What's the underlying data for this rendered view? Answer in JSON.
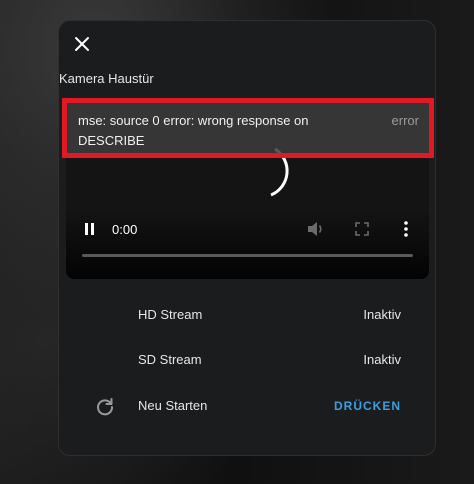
{
  "dialog": {
    "title": "Kamera Haustür",
    "close_icon": "close-icon"
  },
  "player": {
    "error_message": "mse: source 0 error: wrong response on DESCRIBE",
    "error_tag": "error",
    "time": "0:00",
    "controls": [
      "pause-icon",
      "volume-icon",
      "fullscreen-icon",
      "more-vert-icon"
    ],
    "progress": 0
  },
  "entities": [
    {
      "label": "HD Stream",
      "value": "Inaktiv"
    },
    {
      "label": "SD Stream",
      "value": "Inaktiv"
    },
    {
      "label": "Neu Starten",
      "action": "DRÜCKEN",
      "icon": "restart-icon"
    }
  ],
  "colors": {
    "highlight_border": "#e01a24",
    "action_accent": "#3aa0e0",
    "dialog_bg": "#1b1c1d"
  }
}
